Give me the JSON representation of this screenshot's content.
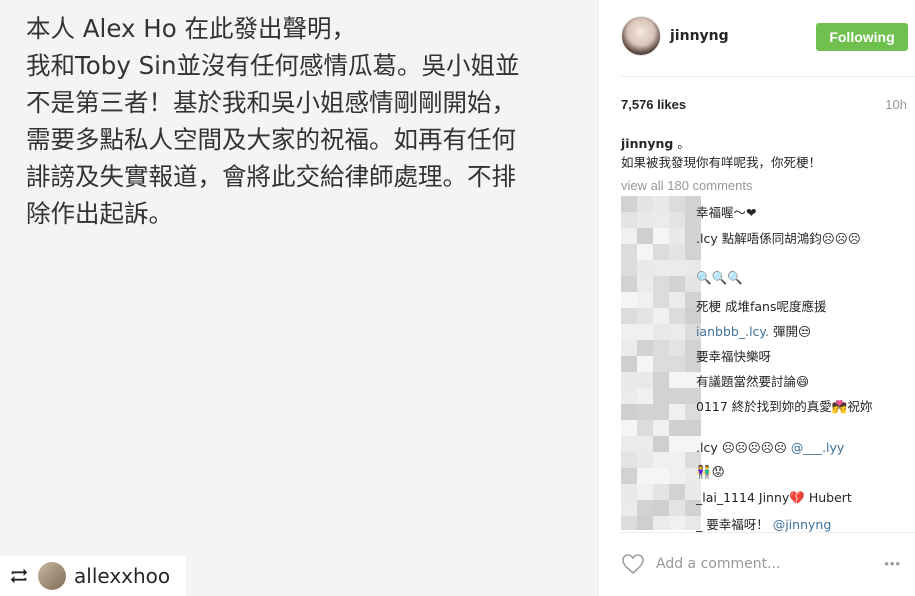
{
  "photo": {
    "statement_lines": [
      "本人 Alex Ho 在此發出聲明，",
      "我和Toby Sin並沒有任何感情瓜葛。吳小姐並",
      "不是第三者！基於我和吳小姐感情剛剛開始，",
      "需要多點私人空間及大家的祝福。如再有任何",
      "誹謗及失實報道，會將此交給律師處理。不排",
      "除作出起訴。"
    ],
    "repost_username": "allexxhoo",
    "repost_icon": "repost-icon"
  },
  "header": {
    "username": "jinnyng",
    "follow_label": "Following",
    "follow_color": "#70c050"
  },
  "stats": {
    "likes": "7,576 likes",
    "time": "10h"
  },
  "caption": {
    "username": "jinnyng",
    "line1": "。",
    "line2": "如果被我發現你有咩呢我，你死梗！"
  },
  "view_all": "view all 180 comments",
  "comments": [
    {
      "text": "幸福喔～❤"
    },
    {
      "text": ".lcy 點解唔係同胡鴻鈞☹☹☹"
    },
    {
      "text": "🔍🔍🔍"
    },
    {
      "text": "死梗 成堆fans呢度應援"
    },
    {
      "text_mention": "ianbbb_.lcy.",
      "text": " 彈開😒"
    },
    {
      "text": "要幸福快樂呀"
    },
    {
      "text": "有議題當然要討論😄"
    },
    {
      "text": "0117 終於找到妳的真愛💏祝妳"
    },
    {
      "text": ".lcy ☹☹☹☹☹ ",
      "text_mention": "@___.lyy"
    },
    {
      "text": "👫😟"
    },
    {
      "text": "_lai_1114 Jinny💔 Hubert"
    },
    {
      "text": "_ 要幸福呀！ ",
      "text_mention": "@jinnyng"
    }
  ],
  "footer": {
    "add_comment_placeholder": "Add a comment...",
    "more_label": "•••",
    "heart_icon": "heart-outline-icon"
  }
}
